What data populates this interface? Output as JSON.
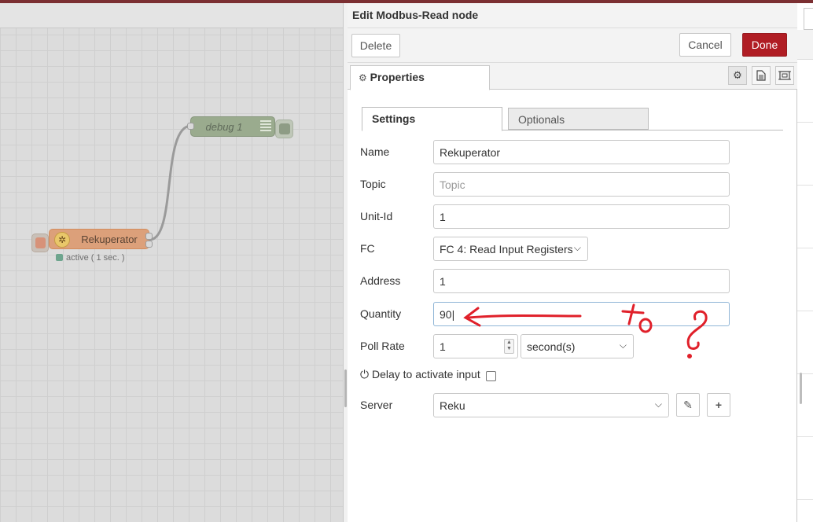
{
  "canvas": {
    "debug_node_label": "debug 1",
    "rekuperator_node_label": "Rekuperator",
    "rekuperator_status": "active ( 1 sec. )",
    "colors": {
      "debug_node": "#9aab8e",
      "modbus_node": "#dca07a",
      "status_dot": "#6ea58e"
    }
  },
  "tray": {
    "title": "Edit Modbus-Read node",
    "delete_label": "Delete",
    "cancel_label": "Cancel",
    "done_label": "Done",
    "properties_tab": "Properties",
    "tab_icons": [
      "gear-icon",
      "document-icon",
      "frame-icon"
    ]
  },
  "subtabs": {
    "settings": "Settings",
    "optionals": "Optionals"
  },
  "form": {
    "name_label": "Name",
    "name_value": "Rekuperator",
    "topic_label": "Topic",
    "topic_placeholder": "Topic",
    "unitid_label": "Unit-Id",
    "unitid_value": "1",
    "fc_label": "FC",
    "fc_value": "FC 4: Read Input Registers",
    "address_label": "Address",
    "address_value": "1",
    "quantity_label": "Quantity",
    "quantity_value": "90|",
    "pollrate_label": "Poll Rate",
    "pollrate_value": "1",
    "pollrate_unit": "second(s)",
    "delay_label": "Delay to activate input",
    "server_label": "Server",
    "server_value": "Reku"
  },
  "colors": {
    "accent_done": "#b01d24",
    "annotation": "#e0202a"
  }
}
